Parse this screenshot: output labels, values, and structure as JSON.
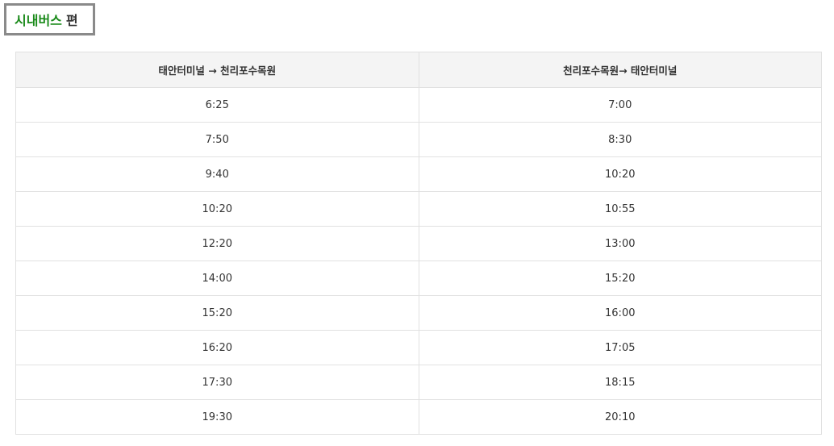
{
  "title": {
    "accent": "시내버스",
    "rest": "편"
  },
  "table": {
    "headers": [
      "태안터미널 → 천리포수목원",
      "천리포수목원→ 태안터미널"
    ],
    "rows": [
      [
        "6:25",
        "7:00"
      ],
      [
        "7:50",
        "8:30"
      ],
      [
        "9:40",
        "10:20"
      ],
      [
        "10:20",
        "10:55"
      ],
      [
        "12:20",
        "13:00"
      ],
      [
        "14:00",
        "15:20"
      ],
      [
        "15:20",
        "16:00"
      ],
      [
        "16:20",
        "17:05"
      ],
      [
        "17:30",
        "18:15"
      ],
      [
        "19:30",
        "20:10"
      ]
    ]
  },
  "colors": {
    "accent": "#1a8a1a",
    "header_bg": "#f4f4f4",
    "border": "#e1e1e1",
    "title_border": "#8a8a8a"
  }
}
